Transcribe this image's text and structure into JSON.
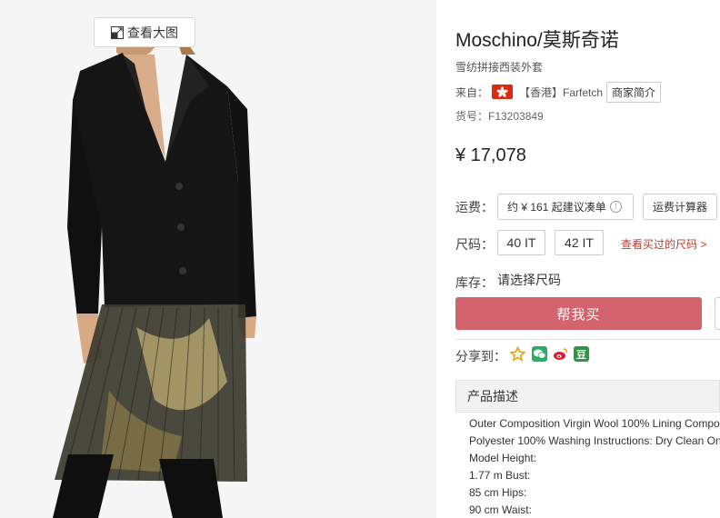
{
  "gallery": {
    "view_large_label": "查看大图"
  },
  "product": {
    "brand_title": "Moschino/莫斯奇诺",
    "subtitle": "雪纺拼接西装外套",
    "origin_label": "来自：",
    "origin_store": "【香港】Farfetch",
    "store_intro_label": "商家简介",
    "sku_text": "货号：F13203849",
    "price": "¥ 17,078"
  },
  "shipping": {
    "label": "运费：",
    "estimate": "约 ¥ 161 起建议凑单",
    "calculator_label": "运费计算器"
  },
  "size": {
    "label": "尺码：",
    "options": [
      "40 IT",
      "42 IT"
    ],
    "history_link": "查看买过的尺码 >"
  },
  "stock": {
    "label": "库存：",
    "value": "请选择尺码"
  },
  "buy": {
    "button_label": "帮我买"
  },
  "share": {
    "label": "分享到：",
    "icons": [
      "favorite-star-icon",
      "wechat-icon",
      "weibo-icon",
      "douban-icon"
    ],
    "douban_text": "豆"
  },
  "description": {
    "heading": "产品描述",
    "lines": [
      "Outer Composition Virgin Wool 100% Lining Compo",
      "Polyester 100% Washing Instructions: Dry Clean On",
      "Model Height:",
      "1.77 m Bust:",
      "85 cm Hips:",
      "90 cm Waist:"
    ]
  },
  "colors": {
    "buy_button": "#d3636c",
    "flag_red": "#de2910",
    "link_red": "#c0392b",
    "wechat_green": "#2aae67",
    "douban_green": "#2e963d",
    "star_gold": "#e8a400"
  }
}
